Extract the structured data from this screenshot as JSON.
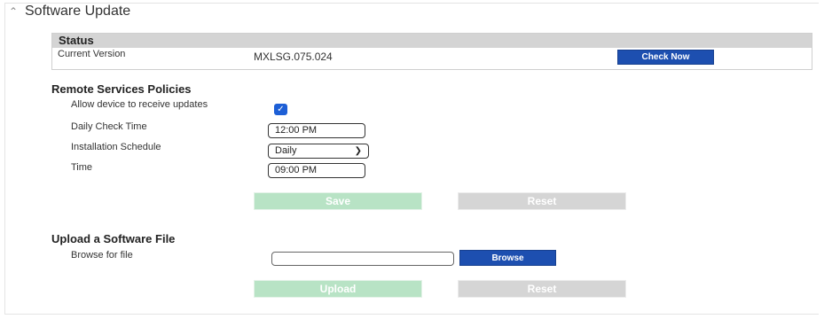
{
  "header": {
    "icon": "double-chevron-up-icon",
    "title": "Software Update"
  },
  "status": {
    "heading": "Status",
    "current_version_label": "Current Version",
    "current_version_value": "MXLSG.075.024",
    "check_now_label": "Check Now"
  },
  "remote": {
    "heading": "Remote Services Policies",
    "allow_label": "Allow device to receive updates",
    "allow_checked": true,
    "daily_check_label": "Daily Check Time",
    "daily_check_value": "12:00 PM",
    "schedule_label": "Installation Schedule",
    "schedule_value": "Daily",
    "time_label": "Time",
    "time_value": "09:00 PM",
    "save_label": "Save",
    "reset_label": "Reset"
  },
  "upload": {
    "heading": "Upload a Software File",
    "browse_label": "Browse for file",
    "file_value": "",
    "browse_button": "Browse",
    "upload_button": "Upload",
    "reset_label": "Reset"
  },
  "colors": {
    "primary_blue": "#1d4fb0",
    "checkbox_blue": "#1d5fd6",
    "disabled_green": "#b8e3c5",
    "disabled_gray": "#d5d5d5",
    "status_bar": "#d4d4d4"
  }
}
